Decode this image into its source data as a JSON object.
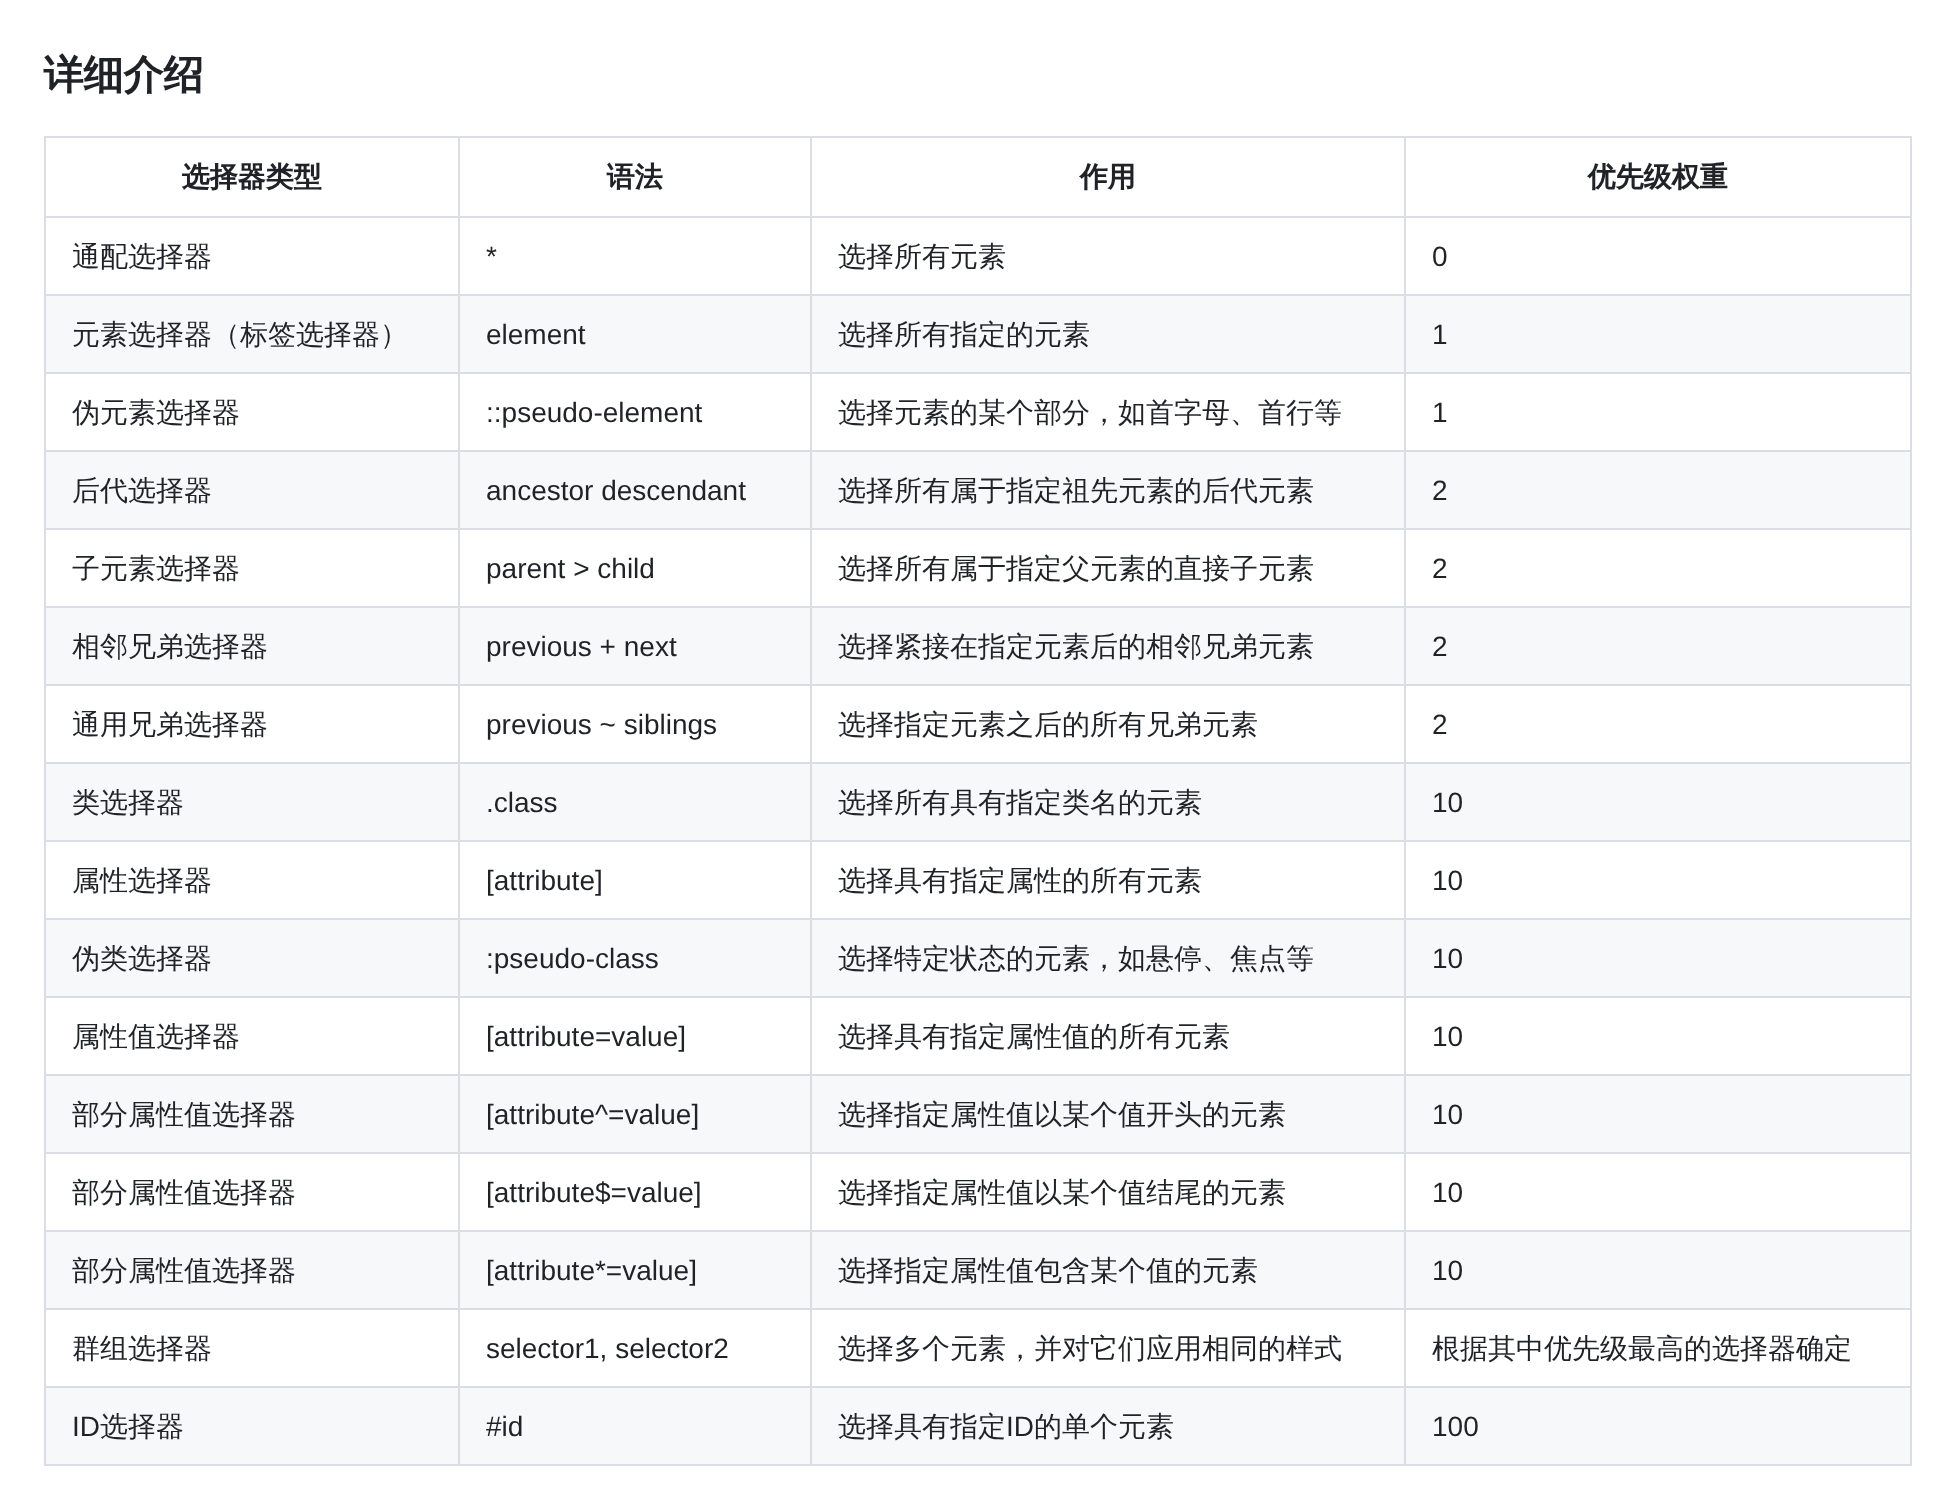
{
  "heading": "详细介绍",
  "table": {
    "columns": [
      "选择器类型",
      "语法",
      "作用",
      "优先级权重"
    ],
    "rows": [
      [
        "通配选择器",
        "*",
        "选择所有元素",
        "0"
      ],
      [
        "元素选择器（标签选择器）",
        "element",
        "选择所有指定的元素",
        "1"
      ],
      [
        "伪元素选择器",
        "::pseudo-element",
        "选择元素的某个部分，如首字母、首行等",
        "1"
      ],
      [
        "后代选择器",
        "ancestor descendant",
        "选择所有属于指定祖先元素的后代元素",
        "2"
      ],
      [
        "子元素选择器",
        "parent > child",
        "选择所有属于指定父元素的直接子元素",
        "2"
      ],
      [
        "相邻兄弟选择器",
        "previous + next",
        "选择紧接在指定元素后的相邻兄弟元素",
        "2"
      ],
      [
        "通用兄弟选择器",
        "previous ~ siblings",
        "选择指定元素之后的所有兄弟元素",
        "2"
      ],
      [
        "类选择器",
        ".class",
        "选择所有具有指定类名的元素",
        "10"
      ],
      [
        "属性选择器",
        "[attribute]",
        "选择具有指定属性的所有元素",
        "10"
      ],
      [
        "伪类选择器",
        ":pseudo-class",
        "选择特定状态的元素，如悬停、焦点等",
        "10"
      ],
      [
        "属性值选择器",
        "[attribute=value]",
        "选择具有指定属性值的所有元素",
        "10"
      ],
      [
        "部分属性值选择器",
        "[attribute^=value]",
        "选择指定属性值以某个值开头的元素",
        "10"
      ],
      [
        "部分属性值选择器",
        "[attribute$=value]",
        "选择指定属性值以某个值结尾的元素",
        "10"
      ],
      [
        "部分属性值选择器",
        "[attribute*=value]",
        "选择指定属性值包含某个值的元素",
        "10"
      ],
      [
        "群组选择器",
        "selector1, selector2",
        "选择多个元素，并对它们应用相同的样式",
        "根据其中优先级最高的选择器确定"
      ],
      [
        "ID选择器",
        "#id",
        "选择具有指定ID的单个元素",
        "100"
      ]
    ]
  }
}
